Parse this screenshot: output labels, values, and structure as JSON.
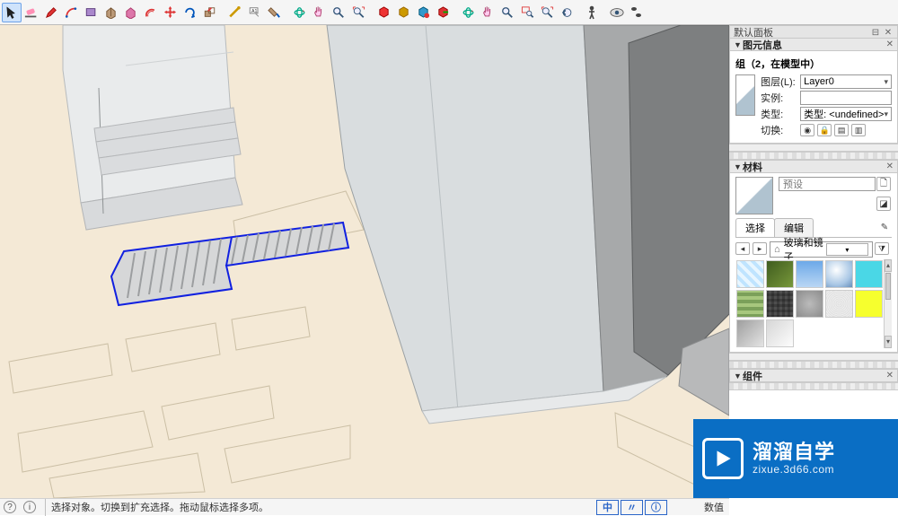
{
  "toolbar": {
    "buttons": [
      {
        "name": "select-arrow-icon",
        "active": true,
        "svg": "cursor"
      },
      {
        "name": "eraser-icon",
        "svg": "eraser"
      },
      {
        "name": "pencil-icon",
        "svg": "pencil"
      },
      {
        "name": "arc-icon",
        "svg": "arc"
      },
      {
        "name": "rectangle-icon",
        "svg": "rect"
      },
      {
        "name": "pull-icon",
        "svg": "pull"
      },
      {
        "name": "pull2-icon",
        "svg": "pull2"
      },
      {
        "name": "offset-icon",
        "svg": "offset"
      },
      {
        "name": "move-icon",
        "svg": "move"
      },
      {
        "name": "rotate-icon",
        "svg": "rotate"
      },
      {
        "name": "scale-icon",
        "svg": "scale"
      },
      {
        "name": "_sep"
      },
      {
        "name": "tape-icon",
        "svg": "tape"
      },
      {
        "name": "text-icon",
        "svg": "text"
      },
      {
        "name": "paint-icon",
        "svg": "paint"
      },
      {
        "name": "_sep"
      },
      {
        "name": "orbit-icon",
        "svg": "orbit"
      },
      {
        "name": "pan-icon",
        "svg": "pan"
      },
      {
        "name": "zoom-icon",
        "svg": "zoom"
      },
      {
        "name": "zoom-extents-icon",
        "svg": "zoomext"
      },
      {
        "name": "_sep"
      },
      {
        "name": "component-icon",
        "svg": "comp1"
      },
      {
        "name": "component2-icon",
        "svg": "comp2"
      },
      {
        "name": "component3-icon",
        "svg": "comp3"
      },
      {
        "name": "component4-icon",
        "svg": "comp4"
      },
      {
        "name": "_sep"
      },
      {
        "name": "orbit2-icon",
        "svg": "orbit"
      },
      {
        "name": "pan2-icon",
        "svg": "pan"
      },
      {
        "name": "zoom2-icon",
        "svg": "zoom"
      },
      {
        "name": "zoom-window-icon",
        "svg": "zoomwin"
      },
      {
        "name": "zoom-extents2-icon",
        "svg": "zoomext"
      },
      {
        "name": "prev-view-icon",
        "svg": "prev"
      },
      {
        "name": "_sep"
      },
      {
        "name": "person-icon",
        "svg": "person"
      },
      {
        "name": "_sep"
      },
      {
        "name": "eye-icon",
        "svg": "eye"
      },
      {
        "name": "walk-icon",
        "svg": "walk"
      }
    ]
  },
  "status": {
    "hint": "选择对象。切换到扩充选择。拖动鼠标选择多项。",
    "coord_label": "数值",
    "boxes": [
      "中",
      "〃",
      "ⓘ"
    ]
  },
  "panels": {
    "host_title": "默认面板",
    "entity": {
      "title": "图元信息",
      "name": "组（2，在模型中）",
      "fields": {
        "layer_label": "图层(L):",
        "layer_value": "Layer0",
        "instance_label": "实例:",
        "instance_value": "",
        "type_label": "类型:",
        "type_value": "类型: <undefined>",
        "toggle_label": "切换:"
      }
    },
    "materials": {
      "title": "材料",
      "current_name": "预设",
      "tabs": {
        "select": "选择",
        "edit": "编辑"
      },
      "library": "玻璃和镜子"
    },
    "components": {
      "title": "组件"
    }
  },
  "watermark": {
    "big": "溜溜自学",
    "small": "zixue.3d66.com"
  }
}
